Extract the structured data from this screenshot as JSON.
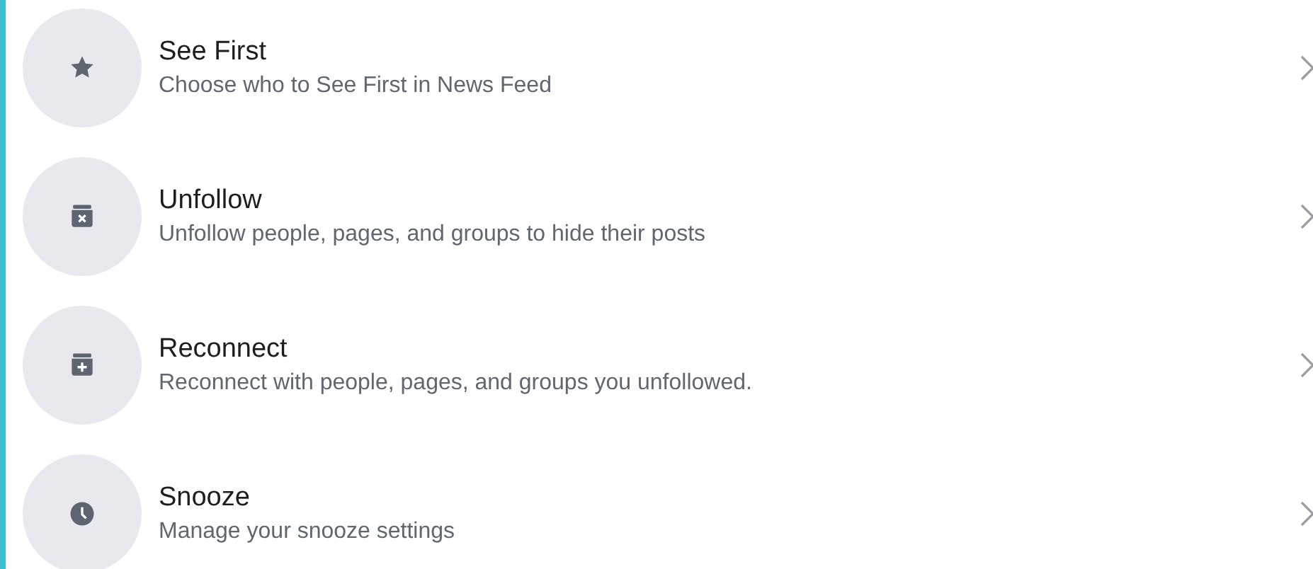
{
  "items": [
    {
      "title": "See First",
      "subtitle": "Choose who to See First in News Feed"
    },
    {
      "title": "Unfollow",
      "subtitle": "Unfollow people, pages, and groups to hide their posts"
    },
    {
      "title": "Reconnect",
      "subtitle": "Reconnect with people, pages, and groups you unfollowed."
    },
    {
      "title": "Snooze",
      "subtitle": "Manage your snooze settings"
    }
  ]
}
